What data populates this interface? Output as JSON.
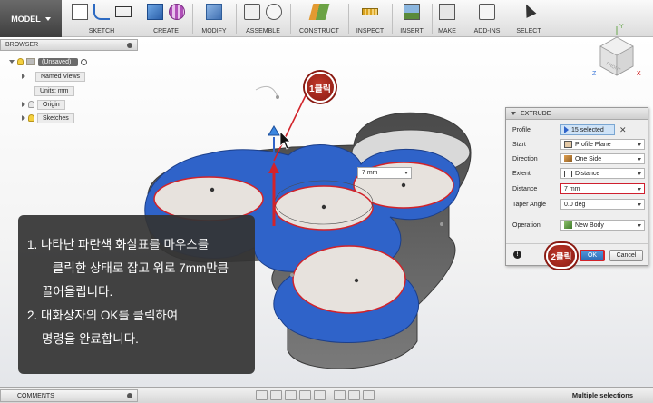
{
  "toolbar": {
    "model_label": "MODEL",
    "groups": [
      "SKETCH",
      "CREATE",
      "MODIFY",
      "ASSEMBLE",
      "CONSTRUCT",
      "INSPECT",
      "INSERT",
      "MAKE",
      "ADD-INS",
      "SELECT"
    ]
  },
  "browser": {
    "title": "BROWSER",
    "root": "(Unsaved)",
    "items": [
      "Named Views",
      "Units: mm",
      "Origin",
      "Sketches"
    ]
  },
  "viewcube": {
    "face_label": "FRONT",
    "axis_x": "X",
    "axis_y": "Y",
    "axis_z": "Z"
  },
  "canvas": {
    "dimension_value": "7 mm"
  },
  "dialog": {
    "title": "EXTRUDE",
    "profile_label": "Profile",
    "profile_value": "15 selected",
    "start_label": "Start",
    "start_value": "Profile Plane",
    "direction_label": "Direction",
    "direction_value": "One Side",
    "extent_label": "Extent",
    "extent_value": "Distance",
    "distance_label": "Distance",
    "distance_value": "7 mm",
    "taper_label": "Taper Angle",
    "taper_value": "0.0 deg",
    "operation_label": "Operation",
    "operation_value": "New Body",
    "ok_label": "OK",
    "cancel_label": "Cancel"
  },
  "badges": {
    "step1": "1클릭",
    "step2": "2클릭"
  },
  "instructions": {
    "line1": "1. 나타난 파란색 화살표를 마우스를",
    "line2": "클릭한 상태로 잡고 위로 7mm만큼",
    "line3": "끌어올립니다.",
    "line4": "2. 대화상자의 OK를 클릭하여",
    "line5": "명령을 완료합니다."
  },
  "bottom": {
    "comments_label": "COMMENTS",
    "status": "Multiple selections"
  },
  "colors": {
    "accent_blue": "#2f63c9",
    "annotation_red": "#d2232a",
    "body_gray": "#6e6e6e"
  }
}
